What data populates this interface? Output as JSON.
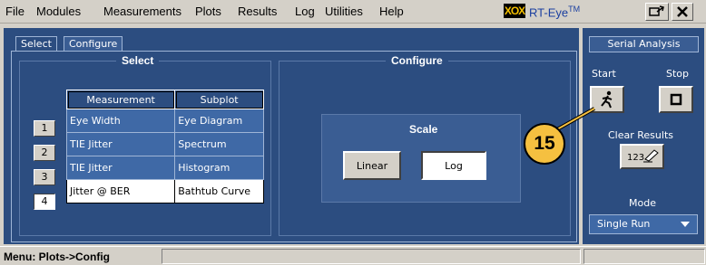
{
  "menu": {
    "items": [
      "File",
      "Modules",
      "Measurements",
      "Plots",
      "Results",
      "Log",
      "Utilities",
      "Help"
    ],
    "brand_logo": "XOX",
    "brand_name": "RT-Eye",
    "brand_mark": "TM"
  },
  "tabs": {
    "select": "Select",
    "configure": "Configure"
  },
  "select_group": {
    "title": "Select",
    "headers": {
      "measurement": "Measurement",
      "subplot": "Subplot"
    },
    "rows": [
      {
        "num": "1",
        "measurement": "Eye Width",
        "subplot": "Eye Diagram"
      },
      {
        "num": "2",
        "measurement": "TIE Jitter",
        "subplot": "Spectrum"
      },
      {
        "num": "3",
        "measurement": "TIE Jitter",
        "subplot": "Histogram"
      },
      {
        "num": "4",
        "measurement": "Jitter @ BER",
        "subplot": "Bathtub Curve"
      }
    ]
  },
  "configure_group": {
    "title": "Configure",
    "scale_title": "Scale",
    "linear_label": "Linear",
    "log_label": "Log"
  },
  "serial_analysis": {
    "title": "Serial Analysis",
    "start_label": "Start",
    "stop_label": "Stop",
    "clear_results_label": "Clear Results",
    "mode_label": "Mode",
    "mode_value": "Single Run"
  },
  "callout": {
    "number": "15"
  },
  "status": {
    "text": "Menu: Plots->Config"
  }
}
